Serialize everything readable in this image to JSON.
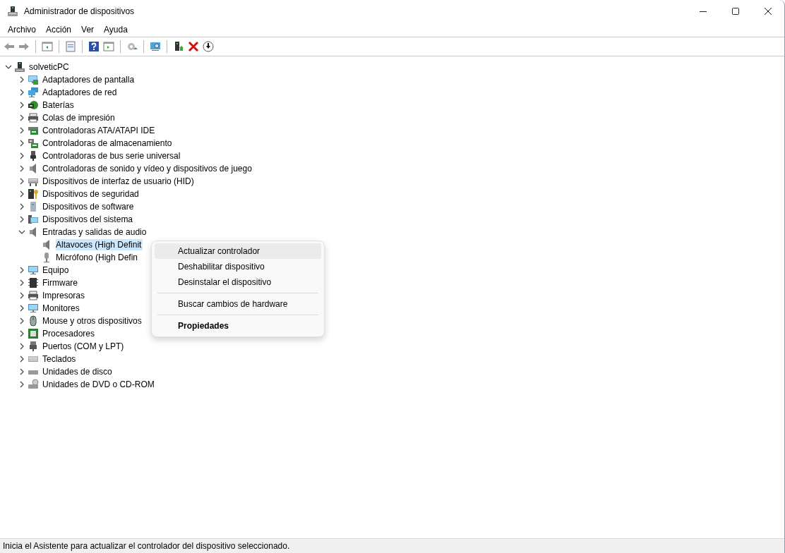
{
  "window": {
    "title": "Administrador de dispositivos"
  },
  "menu_bar": [
    "Archivo",
    "Acción",
    "Ver",
    "Ayuda"
  ],
  "tree": {
    "label": "solveticPC",
    "kind": "computer",
    "expanded": true,
    "selected": false,
    "children": [
      {
        "label": "Adaptadores de pantalla",
        "kind": "display",
        "expanded": false,
        "selected": false
      },
      {
        "label": "Adaptadores de red",
        "kind": "network",
        "expanded": false,
        "selected": false
      },
      {
        "label": "Baterías",
        "kind": "battery",
        "expanded": false,
        "selected": false
      },
      {
        "label": "Colas de impresión",
        "kind": "printer",
        "expanded": false,
        "selected": false
      },
      {
        "label": "Controladoras ATA/ATAPI IDE",
        "kind": "ide",
        "expanded": false,
        "selected": false
      },
      {
        "label": "Controladoras de almacenamiento",
        "kind": "storage",
        "expanded": false,
        "selected": false
      },
      {
        "label": "Controladoras de bus serie universal",
        "kind": "usb",
        "expanded": false,
        "selected": false
      },
      {
        "label": "Controladoras de sonido y vídeo y dispositivos de juego",
        "kind": "speaker",
        "expanded": false,
        "selected": false
      },
      {
        "label": "Dispositivos de interfaz de usuario (HID)",
        "kind": "hid",
        "expanded": false,
        "selected": false
      },
      {
        "label": "Dispositivos de seguridad",
        "kind": "security",
        "expanded": false,
        "selected": false
      },
      {
        "label": "Dispositivos de software",
        "kind": "software",
        "expanded": false,
        "selected": false
      },
      {
        "label": "Dispositivos del sistema",
        "kind": "system",
        "expanded": false,
        "selected": false
      },
      {
        "label": "Entradas y salidas de audio",
        "kind": "speaker",
        "expanded": true,
        "selected": false,
        "children": [
          {
            "label": "Altavoces (High Definit",
            "kind": "speaker",
            "selected": true
          },
          {
            "label": "Micrófono (High Defin",
            "kind": "microphone",
            "selected": false
          }
        ]
      },
      {
        "label": "Equipo",
        "kind": "monitor",
        "expanded": false,
        "selected": false
      },
      {
        "label": "Firmware",
        "kind": "chip",
        "expanded": false,
        "selected": false
      },
      {
        "label": "Impresoras",
        "kind": "printer",
        "expanded": false,
        "selected": false
      },
      {
        "label": "Monitores",
        "kind": "monitor",
        "expanded": false,
        "selected": false
      },
      {
        "label": "Mouse y otros dispositivos",
        "kind": "mouse",
        "expanded": false,
        "selected": false
      },
      {
        "label": "Procesadores",
        "kind": "cpu",
        "expanded": false,
        "selected": false
      },
      {
        "label": "Puertos (COM y LPT)",
        "kind": "port",
        "expanded": false,
        "selected": false
      },
      {
        "label": "Teclados",
        "kind": "keyboard",
        "expanded": false,
        "selected": false
      },
      {
        "label": "Unidades de disco",
        "kind": "disk",
        "expanded": false,
        "selected": false
      },
      {
        "label": "Unidades de DVD o CD-ROM",
        "kind": "dvd",
        "expanded": false,
        "selected": false
      }
    ]
  },
  "context_menu": [
    {
      "kind": "item",
      "label": "Actualizar controlador",
      "highlighted": true,
      "default": false
    },
    {
      "kind": "item",
      "label": "Deshabilitar dispositivo",
      "highlighted": false,
      "default": false
    },
    {
      "kind": "item",
      "label": "Desinstalar el dispositivo",
      "highlighted": false,
      "default": false
    },
    {
      "kind": "separator"
    },
    {
      "kind": "item",
      "label": "Buscar cambios de hardware",
      "highlighted": false,
      "default": false
    },
    {
      "kind": "separator"
    },
    {
      "kind": "item",
      "label": "Propiedades",
      "highlighted": false,
      "default": true
    }
  ],
  "status_bar": {
    "text": "Inicia el Asistente para actualizar el controlador del dispositivo seleccionado."
  }
}
